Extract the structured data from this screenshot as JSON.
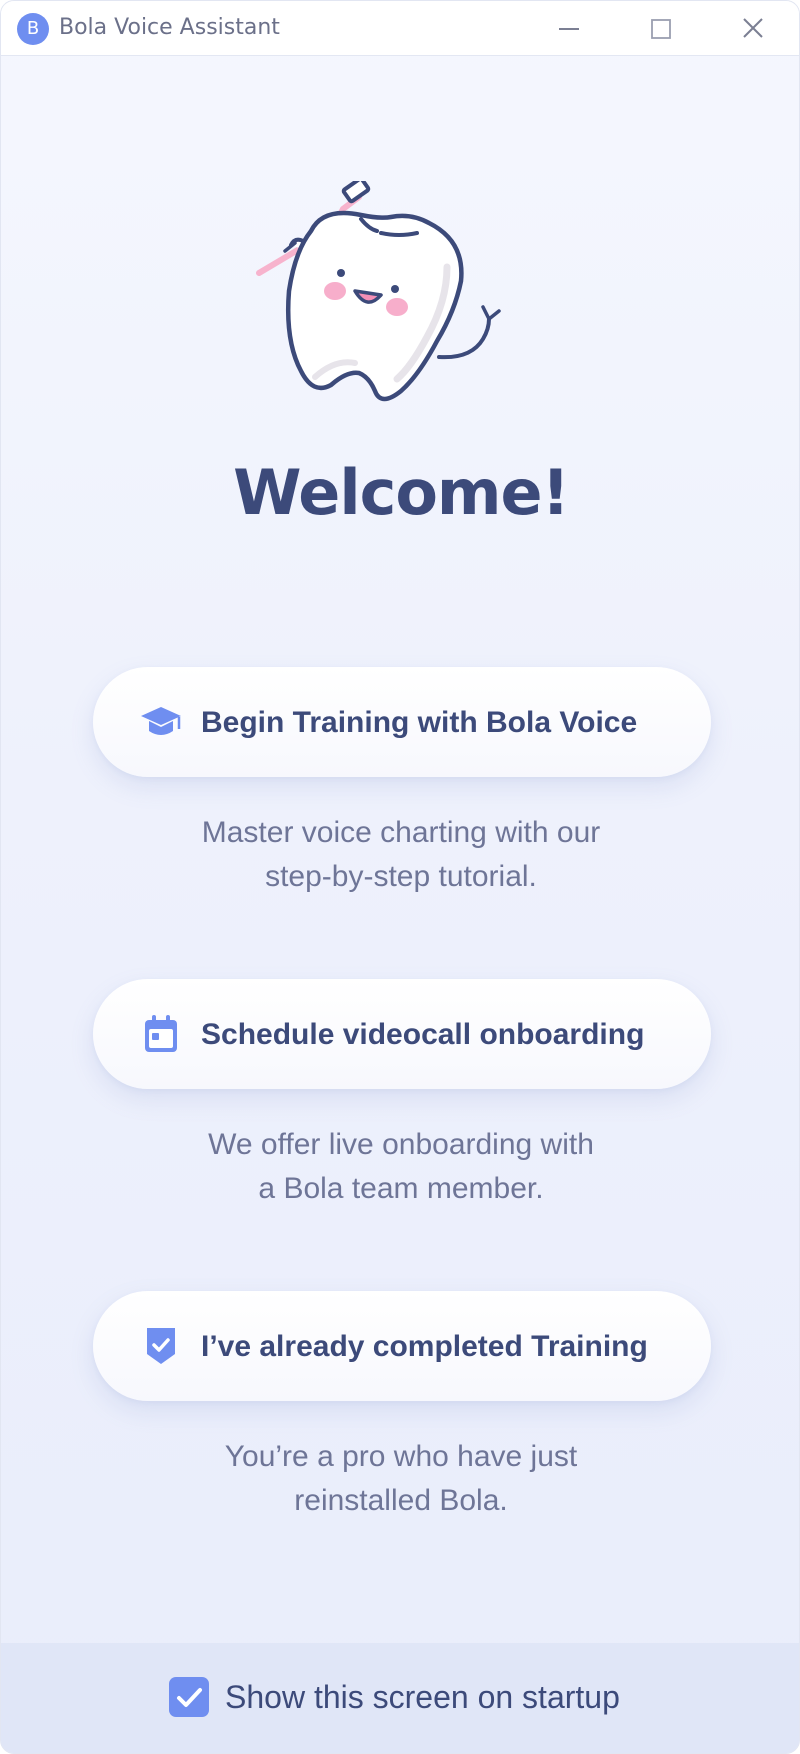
{
  "window": {
    "title": "Bola Voice Assistant",
    "logo_letter": "B"
  },
  "controls": {
    "minimize": "minimize-icon",
    "maximize": "maximize-icon",
    "close": "close-icon"
  },
  "main": {
    "heading": "Welcome!",
    "options": [
      {
        "label": "Begin Training with Bola Voice",
        "icon": "graduation-cap-icon",
        "description": [
          "Master voice charting with our",
          "step-by-step tutorial."
        ]
      },
      {
        "label": "Schedule videocall onboarding",
        "icon": "calendar-icon",
        "description": [
          "We offer live onboarding with",
          "a Bola team member."
        ]
      },
      {
        "label": "I’ve already completed Training",
        "icon": "shield-check-icon",
        "description": [
          "You’re a pro who have just",
          "reinstalled Bola."
        ]
      }
    ]
  },
  "footer": {
    "checkbox_label": "Show this screen on startup",
    "checked": true
  },
  "colors": {
    "accent": "#6f8ef0",
    "heading": "#3c4a7a",
    "body_text": "#6e7597",
    "footer_bg": "#e0e6f7",
    "blush": "#f7aecb"
  }
}
